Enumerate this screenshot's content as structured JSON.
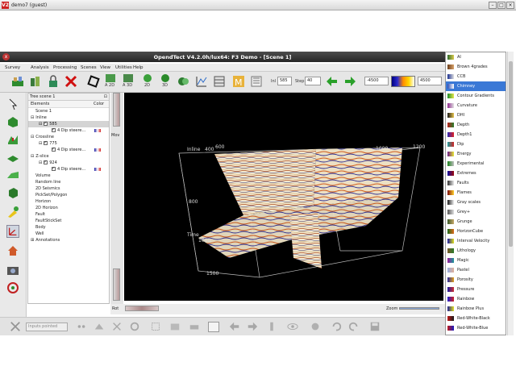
{
  "vnc": {
    "title": "demo7 (guest)",
    "logo": "V2"
  },
  "app": {
    "title": "OpendTect V4.2.0h/lux64: F3 Demo - [Scene 1]"
  },
  "menu": [
    "Survey",
    "Analysis",
    "Processing",
    "Scenes",
    "View",
    "Utilities",
    "Help"
  ],
  "toolbar": {
    "inl_label": "Inl",
    "inl_value": "585",
    "step_label": "Step",
    "step_value": "40",
    "clip_min": "-4500",
    "clip_max": "4500",
    "btn_a2d": "A 2D",
    "btn_a3d": "A 3D",
    "btn_2d": "2D",
    "btn_3d": "3D"
  },
  "tree": {
    "header": "Tree scene 1",
    "col_elements": "Elements",
    "col_color": "Color",
    "rows": [
      {
        "label": "Scene 1",
        "indent": 0,
        "expand": "",
        "check": false
      },
      {
        "label": "Inline",
        "indent": 0,
        "expand": "⊟",
        "check": false
      },
      {
        "label": "585",
        "indent": 1,
        "expand": "⊟",
        "check": true,
        "selected": true
      },
      {
        "label": "4 Dip steere...",
        "indent": 2,
        "expand": "",
        "check": true,
        "colorbar": true
      },
      {
        "label": "Crossline",
        "indent": 0,
        "expand": "⊟",
        "check": false
      },
      {
        "label": "775",
        "indent": 1,
        "expand": "⊟",
        "check": true
      },
      {
        "label": "4 Dip steere...",
        "indent": 2,
        "expand": "",
        "check": true,
        "colorbar": true
      },
      {
        "label": "Z-slice",
        "indent": 0,
        "expand": "⊟",
        "check": false
      },
      {
        "label": "924",
        "indent": 1,
        "expand": "⊟",
        "check": true
      },
      {
        "label": "4 Dip steere...",
        "indent": 2,
        "expand": "",
        "check": true,
        "colorbar": true
      },
      {
        "label": "Volume",
        "indent": 0,
        "expand": "",
        "check": false
      },
      {
        "label": "Random line",
        "indent": 0,
        "expand": "",
        "check": false
      },
      {
        "label": "2D Seismics",
        "indent": 0,
        "expand": "",
        "check": false
      },
      {
        "label": "PickSet/Polygon",
        "indent": 0,
        "expand": "",
        "check": false
      },
      {
        "label": "Horizon",
        "indent": 0,
        "expand": "",
        "check": false
      },
      {
        "label": "2D Horizon",
        "indent": 0,
        "expand": "",
        "check": false
      },
      {
        "label": "Fault",
        "indent": 0,
        "expand": "",
        "check": false
      },
      {
        "label": "FaultStickSet",
        "indent": 0,
        "expand": "",
        "check": false
      },
      {
        "label": "Body",
        "indent": 0,
        "expand": "",
        "check": false
      },
      {
        "label": "Well",
        "indent": 0,
        "expand": "",
        "check": false
      },
      {
        "label": "Annotations",
        "indent": 0,
        "expand": "⊞",
        "check": false
      }
    ]
  },
  "viewer": {
    "slider_label": "Mov",
    "box_labels": [
      "Inline",
      "400",
      "600",
      "1000",
      "1200",
      "800",
      "1000",
      "1500",
      "Time"
    ],
    "rot_label": "Rot",
    "zoom_label": "Zoom"
  },
  "bottom": {
    "mode_select": "Inputs pointed"
  },
  "colortables": {
    "selected": "Chimney",
    "items": [
      {
        "name": "AI",
        "c1": "#2d6a2d",
        "c2": "#d9c94a"
      },
      {
        "name": "Brown 4grades",
        "c1": "#6b3d1a",
        "c2": "#d9a36a"
      },
      {
        "name": "CCB",
        "c1": "#1a2f8f",
        "c2": "#e0e0e0"
      },
      {
        "name": "Chimney",
        "c1": "#2f4fb5",
        "c2": "#ffffff"
      },
      {
        "name": "Contour Gradients",
        "c1": "#1c8c2a",
        "c2": "#e6e64a"
      },
      {
        "name": "Curvature",
        "c1": "#8f2a8f",
        "c2": "#e0e0e0"
      },
      {
        "name": "DHI",
        "c1": "#1a1a1a",
        "c2": "#e6c34a"
      },
      {
        "name": "Depth",
        "c1": "#b82020",
        "c2": "#2a7f2a"
      },
      {
        "name": "Depth1",
        "c1": "#2a2ab8",
        "c2": "#e02020"
      },
      {
        "name": "Dip",
        "c1": "#20a0a0",
        "c2": "#d02020"
      },
      {
        "name": "Energy",
        "c1": "#6a1a8a",
        "c2": "#e8e830"
      },
      {
        "name": "Experimental",
        "c1": "#1a7f1a",
        "c2": "#c0c0c0"
      },
      {
        "name": "Extremes",
        "c1": "#0a0aa0",
        "c2": "#a00a0a"
      },
      {
        "name": "Faults",
        "c1": "#303030",
        "c2": "#e8e8e8"
      },
      {
        "name": "Flames",
        "c1": "#7a0a0a",
        "c2": "#ffd02a"
      },
      {
        "name": "Gray scales",
        "c1": "#1a1a1a",
        "c2": "#f0f0f0"
      },
      {
        "name": "Grey+",
        "c1": "#555555",
        "c2": "#e0e0e0"
      },
      {
        "name": "Grunge",
        "c1": "#3a5a2a",
        "c2": "#c9a96a"
      },
      {
        "name": "HorizonCube",
        "c1": "#1a6a1a",
        "c2": "#e06a1a"
      },
      {
        "name": "Interval Velocity",
        "c1": "#1a1aa0",
        "c2": "#e0e01a"
      },
      {
        "name": "Lithology",
        "c1": "#7a5a2a",
        "c2": "#2a7a2a"
      },
      {
        "name": "Magic",
        "c1": "#9a1a9a",
        "c2": "#1a9a9a"
      },
      {
        "name": "Pastel",
        "c1": "#9ab0e0",
        "c2": "#e0b09a"
      },
      {
        "name": "Porosity",
        "c1": "#2a2a9a",
        "c2": "#e0a01a"
      },
      {
        "name": "Pressure",
        "c1": "#1a1aa0",
        "c2": "#d03030"
      },
      {
        "name": "Rainbow",
        "c1": "#2020d0",
        "c2": "#d02020"
      },
      {
        "name": "Rainbow Plus",
        "c1": "#202090",
        "c2": "#e0e020"
      },
      {
        "name": "Red-White-Black",
        "c1": "#c01a1a",
        "c2": "#1a1a1a"
      },
      {
        "name": "Red-White-Blue",
        "c1": "#c01a1a",
        "c2": "#1a1ac0"
      }
    ]
  }
}
